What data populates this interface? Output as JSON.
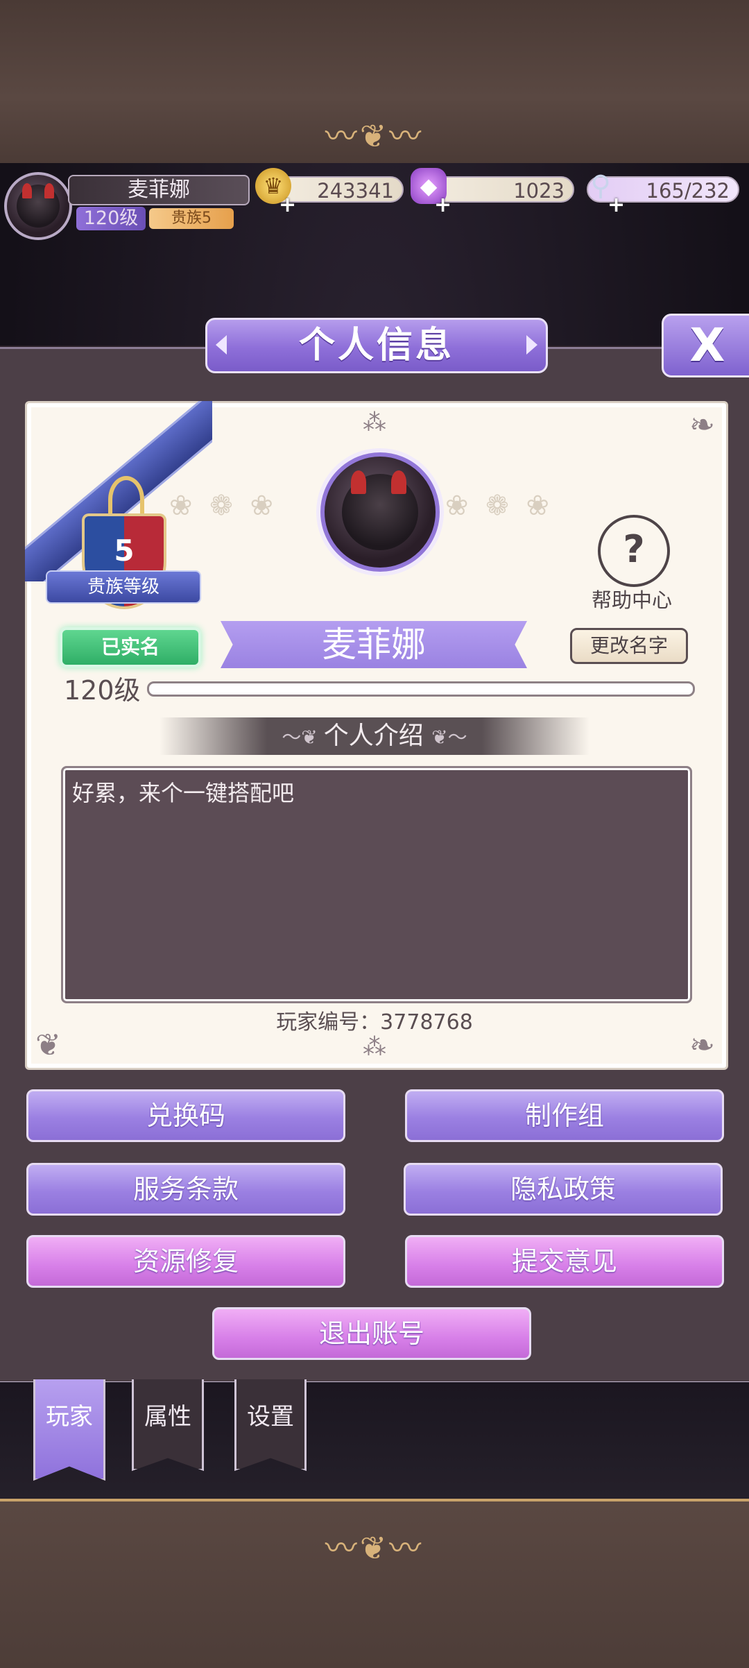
{
  "hud": {
    "player_name": "麦菲娜",
    "level": "120级",
    "noble": "贵族5",
    "gold": "243341",
    "gems": "1023",
    "stamina": "165/232"
  },
  "panel": {
    "title": "个人信息",
    "close_label": "X",
    "noble_badge": {
      "value": "5",
      "label": "贵族等级"
    },
    "help_label": "帮助中心",
    "verified_label": "已实名",
    "name": "麦菲娜",
    "rename_label": "更改名字",
    "level_label": "120级",
    "intro_title": "个人介绍",
    "intro_text": "好累，来个一键搭配吧",
    "player_id": "玩家编号：3778768"
  },
  "buttons": {
    "redeem": "兑换码",
    "credits": "制作组",
    "terms": "服务条款",
    "privacy": "隐私政策",
    "repair": "资源修复",
    "feedback": "提交意见",
    "logout": "退出账号"
  },
  "tabs": [
    {
      "label": "玩家",
      "active": true
    },
    {
      "label": "属性",
      "active": false
    },
    {
      "label": "设置",
      "active": false
    }
  ],
  "colors": {
    "accent": "#9a82e2",
    "pink": "#d77fe8",
    "verified": "#2fae66"
  },
  "icons": {
    "gold": "crown-coin-icon",
    "gem": "diamond-icon",
    "stamina": "glass-slipper-icon",
    "help": "help-book-icon"
  }
}
